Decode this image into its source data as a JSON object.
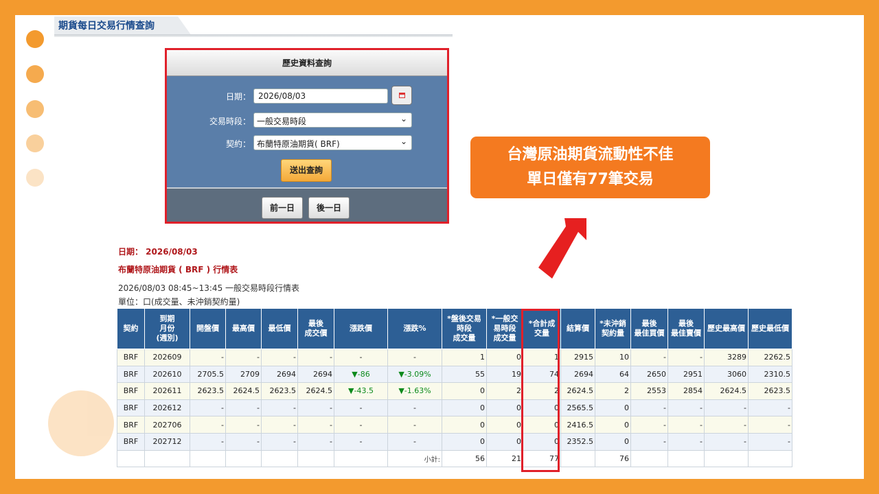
{
  "header": {
    "title": "期貨每日交易行情查詢"
  },
  "query": {
    "panel_title": "歷史資料查詢",
    "date_label": "日期：",
    "date_value": "2026/08/03",
    "session_label": "交易時段：",
    "session_value": "一般交易時段",
    "contract_label": "契約：",
    "contract_value": "布蘭特原油期貨( BRF)",
    "submit_label": "送出查詢",
    "prev_label": "前一日",
    "next_label": "後一日"
  },
  "callout": {
    "line1": "台灣原油期貨流動性不佳",
    "line2": "單日僅有77筆交易",
    "color": "#f47a20"
  },
  "info": {
    "date_line": "日期： 2026/08/03",
    "table_title": "布蘭特原油期貨 ( BRF ) 行情表",
    "session_line": "2026/08/03  08:45~13:45 一般交易時段行情表",
    "unit_line": "單位：口(成交量、未沖銷契約量)"
  },
  "table": {
    "headers": [
      [
        "契約"
      ],
      [
        "到期",
        "月份",
        "(週別)"
      ],
      [
        "開盤價"
      ],
      [
        "最高價"
      ],
      [
        "最低價"
      ],
      [
        "最後",
        "成交價"
      ],
      [
        "漲跌價"
      ],
      [
        "漲跌%"
      ],
      [
        "*盤後交易",
        "時段",
        "成交量"
      ],
      [
        "*一般交",
        "易時段",
        "成交量"
      ],
      [
        "*合計成",
        "交量"
      ],
      [
        "結算價"
      ],
      [
        "*未沖銷",
        "契約量"
      ],
      [
        "最後",
        "最佳買價"
      ],
      [
        "最後",
        "最佳賣價"
      ],
      [
        "歷史最高價"
      ],
      [
        "歷史最低價"
      ]
    ],
    "rows": [
      [
        "BRF",
        "202609",
        "-",
        "-",
        "-",
        "-",
        "-",
        "-",
        "1",
        "0",
        "1",
        "2915",
        "10",
        "-",
        "-",
        "3289",
        "2262.5"
      ],
      [
        "BRF",
        "202610",
        "2705.5",
        "2709",
        "2694",
        "2694",
        "▼-86",
        "▼-3.09%",
        "55",
        "19",
        "74",
        "2694",
        "64",
        "2650",
        "2951",
        "3060",
        "2310.5"
      ],
      [
        "BRF",
        "202611",
        "2623.5",
        "2624.5",
        "2623.5",
        "2624.5",
        "▼-43.5",
        "▼-1.63%",
        "0",
        "2",
        "2",
        "2624.5",
        "2",
        "2553",
        "2854",
        "2624.5",
        "2623.5"
      ],
      [
        "BRF",
        "202612",
        "-",
        "-",
        "-",
        "-",
        "-",
        "-",
        "0",
        "0",
        "0",
        "2565.5",
        "0",
        "-",
        "-",
        "-",
        "-"
      ],
      [
        "BRF",
        "202706",
        "-",
        "-",
        "-",
        "-",
        "-",
        "-",
        "0",
        "0",
        "0",
        "2416.5",
        "0",
        "-",
        "-",
        "-",
        "-"
      ],
      [
        "BRF",
        "202712",
        "-",
        "-",
        "-",
        "-",
        "-",
        "-",
        "0",
        "0",
        "0",
        "2352.5",
        "0",
        "-",
        "-",
        "-",
        "-"
      ]
    ],
    "subtotal": [
      "",
      "",
      "",
      "",
      "",
      "",
      "",
      "小計:",
      "56",
      "21",
      "77",
      "",
      "76",
      "",
      "",
      "",
      ""
    ]
  },
  "colors": {
    "background": "#f39a2e",
    "header_blue": "#2d5f95",
    "highlight_red": "#e0202a",
    "down_green": "#0c8a1c"
  },
  "icons": [
    "calendar-icon",
    "chevron-down-icon",
    "arrow-up-right-icon"
  ]
}
